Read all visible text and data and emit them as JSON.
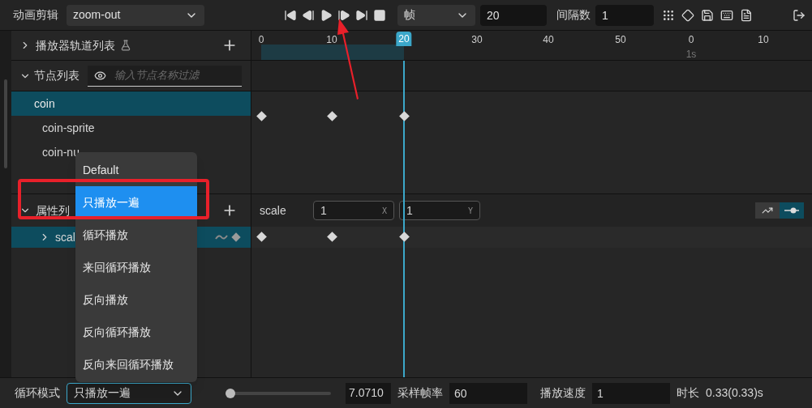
{
  "clip": {
    "label": "动画剪辑",
    "value": "zoom-out"
  },
  "unit": {
    "value": "帧"
  },
  "frame": {
    "value": "20"
  },
  "interval": {
    "label": "间隔数",
    "value": "1"
  },
  "ruler": {
    "ticks": [
      {
        "label": "0",
        "selected": false
      },
      {
        "label": "10",
        "selected": false
      },
      {
        "label": "20",
        "selected": true
      },
      {
        "label": "30",
        "selected": false
      },
      {
        "label": "40",
        "selected": false
      },
      {
        "label": "50",
        "selected": false
      },
      {
        "label": "0",
        "selected": false
      },
      {
        "label": "10",
        "selected": false
      }
    ],
    "second_label": "1s"
  },
  "player_tracks": {
    "title": "播放器轨道列表",
    "expanded": false
  },
  "nodes": {
    "title": "节点列表",
    "expanded": true,
    "filter_placeholder": "输入节点名称过滤",
    "items": [
      {
        "label": "coin",
        "selected": true
      },
      {
        "label": "coin-sprite",
        "selected": false
      },
      {
        "label": "coin-nu",
        "selected": false
      }
    ]
  },
  "properties": {
    "title": "属性列",
    "expanded": true,
    "items": [
      {
        "label": "scal",
        "selected": true
      }
    ]
  },
  "property_editor": {
    "label": "scale",
    "x_value": "1",
    "x_axis": "X",
    "y_value": "1",
    "y_axis": "Y"
  },
  "view_modes": [
    {
      "kind": "curve",
      "selected": false
    },
    {
      "kind": "keyframe",
      "selected": true
    }
  ],
  "loop_menu": [
    {
      "label": "Default",
      "selected": false
    },
    {
      "label": "只播放一遍",
      "selected": true
    },
    {
      "label": "循环播放",
      "selected": false
    },
    {
      "label": "来回循环播放",
      "selected": false
    },
    {
      "label": "反向播放",
      "selected": false
    },
    {
      "label": "反向循环播放",
      "selected": false
    },
    {
      "label": "反向来回循环播放",
      "selected": false
    }
  ],
  "footer": {
    "loop_label": "循环模式",
    "loop_value": "只播放一遍",
    "zoom_slider": {
      "level": 0
    },
    "zoom_value": "7.0710",
    "sample_rate_label": "采样帧率",
    "sample_rate": "60",
    "speed_label": "播放速度",
    "speed": "1",
    "duration_label": "时长",
    "duration": "0.33(0.33)s"
  }
}
